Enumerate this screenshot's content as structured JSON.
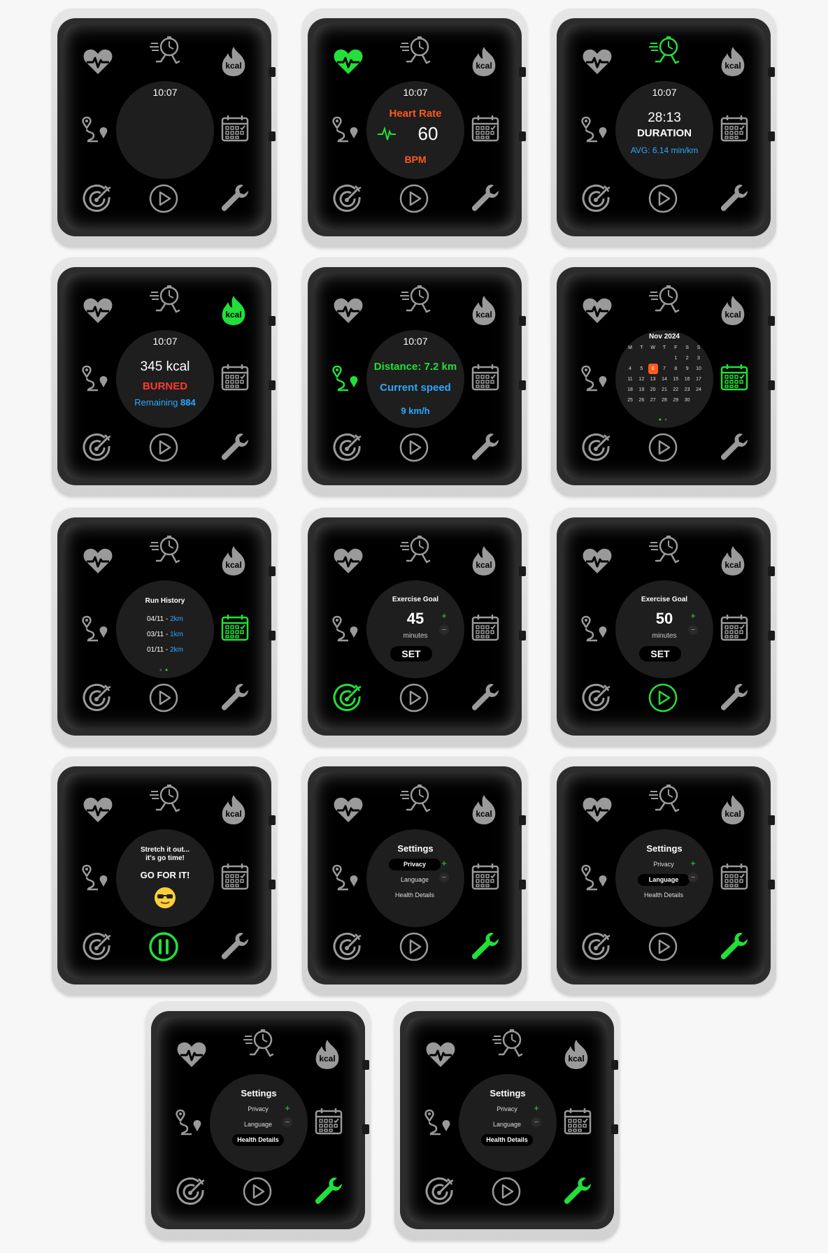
{
  "colors": {
    "active": "#22e03a",
    "inactive": "#9a9a9a",
    "orange": "#ff5a1f",
    "blue": "#2aa8ff",
    "red": "#ff3b30"
  },
  "watches": [
    {
      "active": "none"
    },
    {
      "active": "heart",
      "clock": "10:07",
      "title": "Heart Rate",
      "value": "60",
      "unit": "BPM"
    },
    {
      "active": "run",
      "clock": "10:07",
      "value": "28:13",
      "label": "DURATION",
      "avg": "AVG: 6.14 min/km"
    },
    {
      "active": "fire",
      "clock": "10:07",
      "value": "345 kcal",
      "burned": "BURNED",
      "remaining_label": "Remaining",
      "remaining_value": "884"
    },
    {
      "active": "route",
      "clock": "10:07",
      "distance": "Distance: 7.2 km",
      "speed_label": "Current speed",
      "speed_value": "9 km/h"
    },
    {
      "active": "cal",
      "month": "Nov 2024",
      "weekdays": [
        "M",
        "T",
        "W",
        "T",
        "F",
        "S",
        "S"
      ],
      "weeks": [
        [
          "",
          "",
          "",
          "",
          "1",
          "2",
          "3"
        ],
        [
          "4",
          "5",
          "6",
          "7",
          "8",
          "9",
          "10"
        ],
        [
          "11",
          "12",
          "13",
          "14",
          "15",
          "16",
          "17"
        ],
        [
          "18",
          "19",
          "20",
          "21",
          "22",
          "23",
          "24"
        ],
        [
          "25",
          "26",
          "27",
          "28",
          "29",
          "30",
          ""
        ]
      ],
      "selected_day": "6"
    },
    {
      "active": "cal",
      "title": "Run History",
      "rows": [
        {
          "date": "04/11 - ",
          "km": "2km"
        },
        {
          "date": "03/11 - ",
          "km": "1km"
        },
        {
          "date": "01/11 - ",
          "km": "2km"
        }
      ]
    },
    {
      "active": "target",
      "title": "Exercise Goal",
      "value": "45",
      "unit": "minutes",
      "set": "SET",
      "plus": "+",
      "minus": "–"
    },
    {
      "active": "play",
      "title": "Exercise Goal",
      "value": "50",
      "unit": "minutes",
      "set": "SET",
      "plus": "+",
      "minus": "–"
    },
    {
      "active": "pause",
      "line1": "Stretch it out...",
      "line2": "it's go time!",
      "cta": "GO FOR IT!"
    },
    {
      "active": "wrench",
      "title": "Settings",
      "options": [
        "Privacy",
        "Language",
        "Health Details"
      ],
      "selected": 0,
      "plus": "+",
      "minus": "–"
    },
    {
      "active": "wrench",
      "title": "Settings",
      "options": [
        "Privacy",
        "Language",
        "Health Details"
      ],
      "selected": 1,
      "plus": "+",
      "minus": "–"
    },
    {
      "active": "wrench",
      "title": "Settings",
      "options": [
        "Privacy",
        "Language",
        "Health Details"
      ],
      "selected": 2,
      "plus": "+",
      "minus": "–"
    },
    {
      "active": "wrench",
      "title": "Settings",
      "options": [
        "Privacy",
        "Language",
        "Health Details"
      ],
      "selected": 2,
      "plus": "+",
      "minus": "–"
    }
  ]
}
